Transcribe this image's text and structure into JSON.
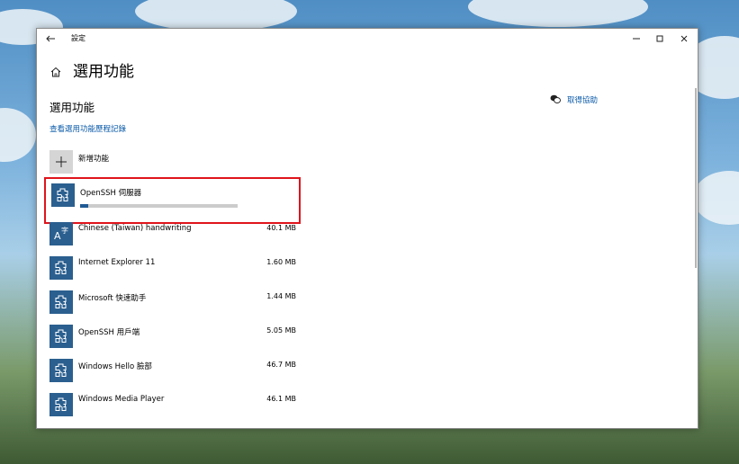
{
  "window": {
    "title": "設定",
    "back_icon": "back-arrow-icon",
    "controls": [
      "minimize-icon",
      "maximize-icon",
      "close-icon"
    ]
  },
  "page": {
    "title": "選用功能",
    "home_icon": "home-icon"
  },
  "section": {
    "title": "選用功能",
    "history_link": "查看選用功能歷程記錄"
  },
  "help": {
    "icon": "chat-help-icon",
    "label": "取得協助"
  },
  "add_feature": {
    "icon": "plus-icon",
    "label": "新增功能"
  },
  "installing": {
    "name": "OpenSSH 伺服器",
    "progress": 0.05,
    "icon": "puzzle-icon"
  },
  "features": [
    {
      "name": "Chinese (Taiwan) handwriting",
      "size": "40.1 MB",
      "icon": "handwriting-icon"
    },
    {
      "name": "Internet Explorer 11",
      "size": "1.60 MB",
      "icon": "puzzle-icon"
    },
    {
      "name": "Microsoft 快速助手",
      "size": "1.44 MB",
      "icon": "puzzle-icon"
    },
    {
      "name": "OpenSSH 用戶端",
      "size": "5.05 MB",
      "icon": "puzzle-icon"
    },
    {
      "name": "Windows Hello 臉部",
      "size": "46.7 MB",
      "icon": "puzzle-icon"
    },
    {
      "name": "Windows Media Player",
      "size": "46.1 MB",
      "icon": "puzzle-icon"
    }
  ],
  "colors": {
    "accent": "#2b5f8f",
    "link": "#0a5aa8",
    "highlight_box": "#e0141c",
    "progress": "#1f5a94"
  }
}
